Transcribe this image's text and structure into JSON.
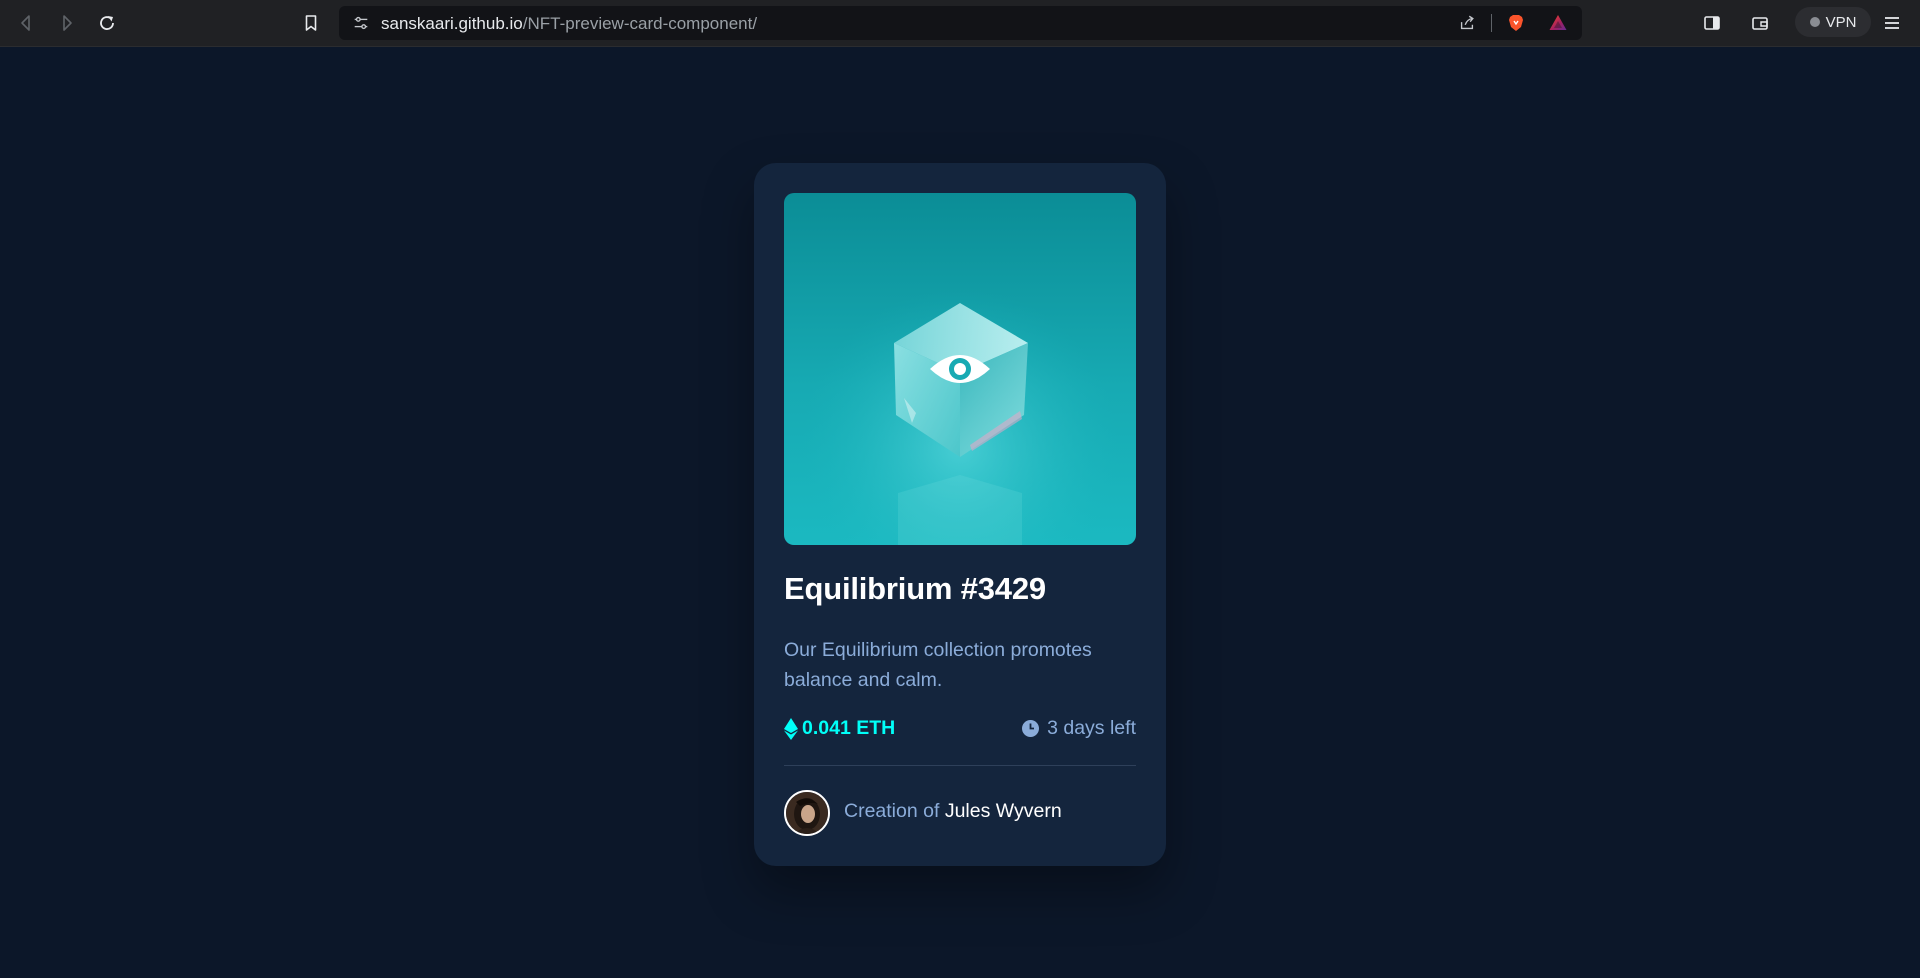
{
  "browser": {
    "url_host": "sanskaari.github.io",
    "url_path": "/NFT-preview-card-component/",
    "vpn_label": "VPN",
    "icons": [
      "back-icon",
      "forward-icon",
      "reload-icon",
      "bookmark-icon",
      "site-settings-icon",
      "share-icon",
      "brave-shields-icon",
      "brave-rewards-icon",
      "sidebar-icon",
      "wallet-icon",
      "menu-icon"
    ]
  },
  "card": {
    "title": "Equilibrium #3429",
    "description": "Our Equilibrium collection promotes balance and calm.",
    "price": "0.041 ETH",
    "time_left": "3 days left",
    "creator_prefix": "Creation of ",
    "creator_name": "Jules Wyvern",
    "image_overlay_icon": "eye-icon"
  },
  "colors": {
    "page_bg": "#0c1729",
    "card_bg": "#14253d",
    "cyan": "#00fff8",
    "soft_blue": "#8bacd9",
    "white": "#ffffff"
  }
}
